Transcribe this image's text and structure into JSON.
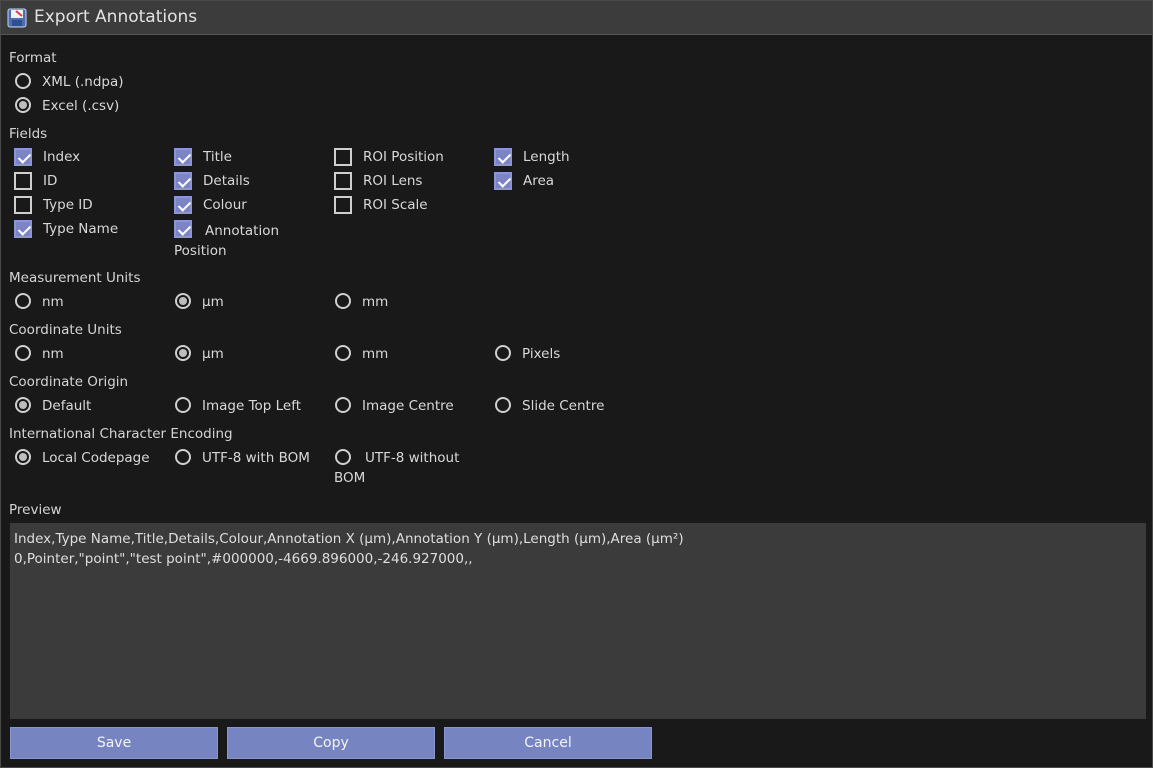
{
  "window": {
    "title": "Export Annotations"
  },
  "format": {
    "label": "Format",
    "options": [
      {
        "label": "XML (.ndpa)",
        "selected": false
      },
      {
        "label": "Excel (.csv)",
        "selected": true
      }
    ]
  },
  "fields": {
    "label": "Fields",
    "items": [
      {
        "label": "Index",
        "checked": true
      },
      {
        "label": "ID",
        "checked": false
      },
      {
        "label": "Type ID",
        "checked": false
      },
      {
        "label": "Type Name",
        "checked": true
      },
      {
        "label": "Title",
        "checked": true
      },
      {
        "label": "Details",
        "checked": true
      },
      {
        "label": "Colour",
        "checked": true
      },
      {
        "label": "Annotation Position",
        "checked": true
      },
      {
        "label": "ROI Position",
        "checked": false
      },
      {
        "label": "ROI Lens",
        "checked": false
      },
      {
        "label": "ROI Scale",
        "checked": false
      },
      {
        "label": "Length",
        "checked": true
      },
      {
        "label": "Area",
        "checked": true
      }
    ]
  },
  "measurement_units": {
    "label": "Measurement Units",
    "options": [
      {
        "label": "nm",
        "selected": false
      },
      {
        "label": "µm",
        "selected": true
      },
      {
        "label": "mm",
        "selected": false
      }
    ]
  },
  "coordinate_units": {
    "label": "Coordinate Units",
    "options": [
      {
        "label": "nm",
        "selected": false
      },
      {
        "label": "µm",
        "selected": true
      },
      {
        "label": "mm",
        "selected": false
      },
      {
        "label": "Pixels",
        "selected": false
      }
    ]
  },
  "coordinate_origin": {
    "label": "Coordinate Origin",
    "options": [
      {
        "label": "Default",
        "selected": true
      },
      {
        "label": "Image Top Left",
        "selected": false
      },
      {
        "label": "Image Centre",
        "selected": false
      },
      {
        "label": "Slide Centre",
        "selected": false
      }
    ]
  },
  "encoding": {
    "label": "International Character Encoding",
    "options": [
      {
        "label": "Local Codepage",
        "selected": true
      },
      {
        "label": "UTF-8 with BOM",
        "selected": false
      },
      {
        "label": "UTF-8 without BOM",
        "selected": false
      }
    ]
  },
  "preview": {
    "label": "Preview",
    "lines": [
      "Index,Type Name,Title,Details,Colour,Annotation X (µm),Annotation Y (µm),Length (µm),Area (µm²)",
      "0,Pointer,\"point\",\"test point\",#000000,-4669.896000,-246.927000,,"
    ]
  },
  "buttons": {
    "save": "Save",
    "copy": "Copy",
    "cancel": "Cancel"
  },
  "colors": {
    "accent": "#7684c2",
    "checkbox_on": "#7b84c4",
    "background": "#191919",
    "preview_bg": "#3b3b3b"
  }
}
